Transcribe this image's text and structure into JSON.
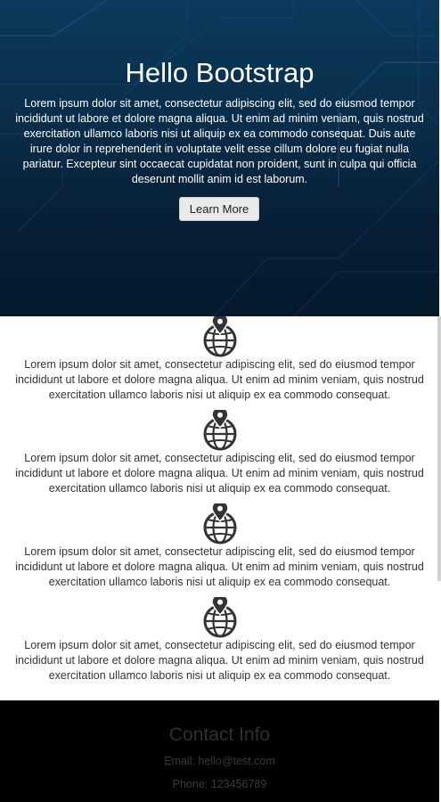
{
  "hero": {
    "title": "Hello Bootstrap",
    "text": "Lorem ipsum dolor sit amet, consectetur adipiscing elit, sed do eiusmod tempor incididunt ut labore et dolore magna aliqua. Ut enim ad minim veniam, quis nostrud exercitation ullamco laboris nisi ut aliquip ex ea commodo consequat. Duis aute irure dolor in reprehenderit in voluptate velit esse cillum dolore eu fugiat nulla pariatur. Excepteur sint occaecat cupidatat non proident, sunt in culpa qui officia deserunt mollit anim id est laborum.",
    "button_label": "Learn More",
    "background_color": "#0a2f4c"
  },
  "features": [
    {
      "icon": "globe-location-icon",
      "text": "Lorem ipsum dolor sit amet, consectetur adipiscing elit, sed do eiusmod tempor incididunt ut labore et dolore magna aliqua. Ut enim ad minim veniam, quis nostrud exercitation ullamco laboris nisi ut aliquip ex ea commodo consequat."
    },
    {
      "icon": "globe-location-icon",
      "text": "Lorem ipsum dolor sit amet, consectetur adipiscing elit, sed do eiusmod tempor incididunt ut labore et dolore magna aliqua. Ut enim ad minim veniam, quis nostrud exercitation ullamco laboris nisi ut aliquip ex ea commodo consequat."
    },
    {
      "icon": "globe-location-icon",
      "text": "Lorem ipsum dolor sit amet, consectetur adipiscing elit, sed do eiusmod tempor incididunt ut labore et dolore magna aliqua. Ut enim ad minim veniam, quis nostrud exercitation ullamco laboris nisi ut aliquip ex ea commodo consequat."
    },
    {
      "icon": "globe-location-icon",
      "text": "Lorem ipsum dolor sit amet, consectetur adipiscing elit, sed do eiusmod tempor incididunt ut labore et dolore magna aliqua. Ut enim ad minim veniam, quis nostrud exercitation ullamco laboris nisi ut aliquip ex ea commodo consequat."
    }
  ],
  "footer": {
    "title": "Contact Info",
    "email": "Email: hello@test.com",
    "phone": "Phone: 123456789",
    "background_color": "#000000"
  }
}
